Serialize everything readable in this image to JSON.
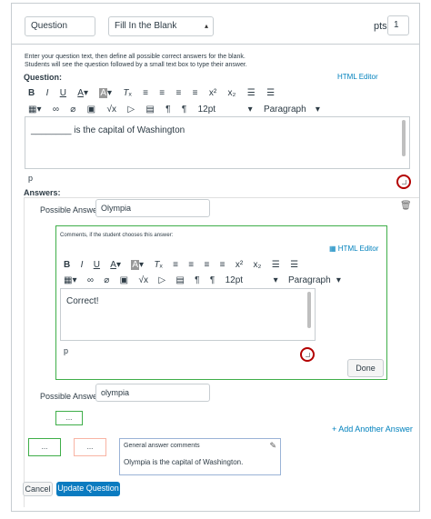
{
  "header": {
    "question_name": "Question",
    "question_type": "Fill In the Blank",
    "pts_label": "pts:",
    "pts_value": "1"
  },
  "instructions": {
    "line1": "Enter your question text, then define all possible correct answers for the blank.",
    "line2": "Students will see the question followed by a small text box to type their answer."
  },
  "question": {
    "label": "Question:",
    "html_editor": "HTML Editor",
    "font_size": "12pt",
    "paragraph": "Paragraph",
    "text": "________ is the capital of Washington",
    "path": "p"
  },
  "answers": {
    "label": "Answers:",
    "possible_answer_label": "Possible Answer:",
    "answer1_value": "Olympia",
    "comments_label": "Comments, if the student chooses this answer:",
    "comment_html_editor": "HTML Editor",
    "comment_font_size": "12pt",
    "comment_paragraph": "Paragraph",
    "comment_text": "Correct!",
    "comment_path": "p",
    "done_label": "Done",
    "answer2_label": "Possible Answer:",
    "answer2_value": "olympia"
  },
  "comments_section": {
    "neutral_box": "...",
    "correct_box": "...",
    "incorrect_box": "...",
    "add_answer": "Add Another Answer",
    "general_label": "General answer comments",
    "general_text": "Olympia is the capital of Washington."
  },
  "footer": {
    "cancel": "Cancel",
    "update": "Update Question"
  },
  "colors": {
    "accent": "#0081bd",
    "update_button": "#0b7bc0",
    "comment_border": "#3fae49",
    "wrong_border": "#f8b4a4",
    "circle": "#b30000"
  }
}
